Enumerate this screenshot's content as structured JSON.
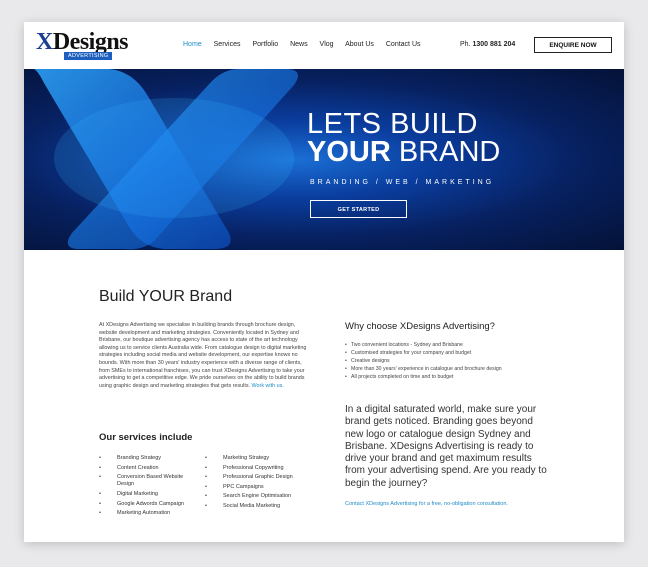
{
  "header": {
    "logo_text": "XDesigns",
    "logo_sub": "ADVERTISING",
    "nav": [
      {
        "label": "Home",
        "active": true
      },
      {
        "label": "Services"
      },
      {
        "label": "Portfolio"
      },
      {
        "label": "News"
      },
      {
        "label": "Vlog"
      },
      {
        "label": "About Us"
      },
      {
        "label": "Contact Us"
      }
    ],
    "phone_prefix": "Ph.",
    "phone_number": "1300 881 204",
    "cta_label": "ENQUIRE NOW"
  },
  "hero": {
    "line1": "LETS BUILD",
    "line2_bold": "YOUR",
    "line2_rest": " BRAND",
    "tagline": "BRANDING / WEB / MARKETING",
    "button_label": "GET STARTED"
  },
  "content": {
    "title": "Build YOUR Brand",
    "intro": "At XDesigns Advertising we specialise in building brands through brochure design, website development and marketing strategies. Conveniently located in Sydney and Brisbane, our boutique advertising agency has access to state of the art technology allowing us to service clients Australia wide. From catalogue design to digital marketing strategies including social media and website development, our expertise knows no bounds. With more than 30 years' industry experience with a diverse range of clients, from SMEs to international franchises, you can trust XDesigns Advertising to take your advertising to get a competitive edge. We pride ourselves on the ability to build brands using graphic design and marketing strategies that gets results.",
    "intro_link": "Work with us.",
    "services_title": "Our services include",
    "services_col1": [
      "Branding Strategy",
      "Content Creation",
      "Conversion Based Website Design",
      "Digital Marketing",
      "Google Adwords Campaign",
      "Marketing Automation"
    ],
    "services_col2": [
      "Marketing Strategy",
      "Professional Copywriting",
      "Professional Graphic Design",
      "PPC Campaigns",
      "Search Engine Optimisation",
      "Social Media Marketing"
    ],
    "why_title": "Why choose XDesigns Advertising?",
    "why_items": [
      "Two convenient locations - Sydney and Brisbane",
      "Customised strategies for your company and budget",
      "Creative designs",
      "More than 30 years' experience in catalogue and brochure design",
      "All projects completed on time and to budget"
    ],
    "quote": "In a digital saturated world, make sure your brand gets noticed. Branding goes beyond new logo or catalogue design Sydney and Brisbane. XDesigns Advertising is ready to drive your brand and get maximum results from your advertising spend. Are you ready to begin the journey?",
    "contact_link": "Contact XDesigns Advertising for a free, no-obligation consultation."
  }
}
